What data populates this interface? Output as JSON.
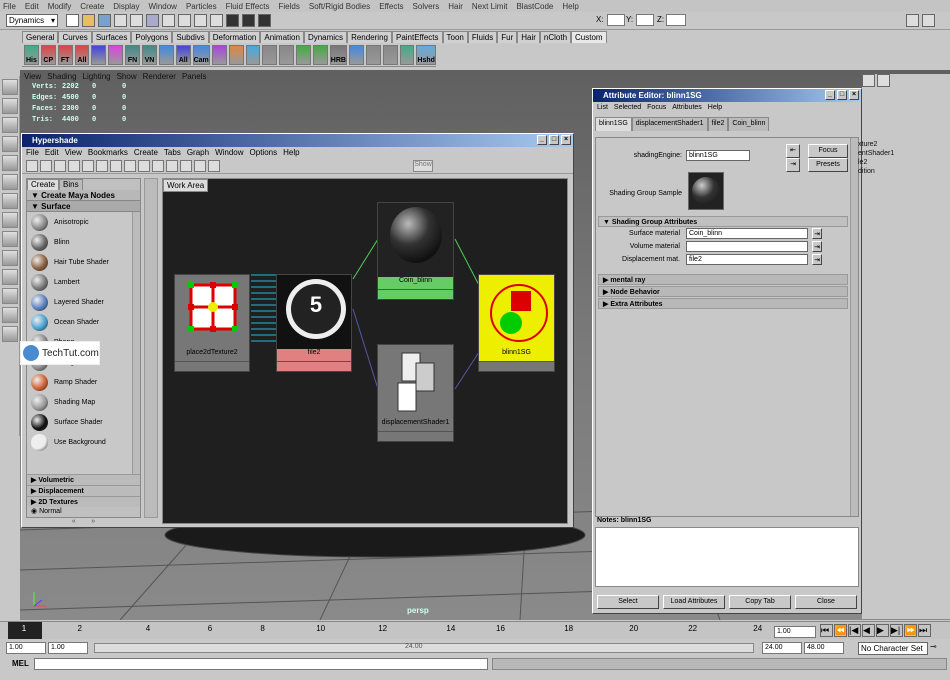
{
  "app": {
    "menu": [
      "File",
      "Edit",
      "Modify",
      "Create",
      "Display",
      "Window",
      "Particles",
      "Fluid Effects",
      "Fields",
      "Soft/Rigid Bodies",
      "Effects",
      "Solvers",
      "Hair",
      "Next Limit",
      "BlastCode",
      "Help"
    ],
    "mode_dropdown": "Dynamics",
    "xyz_labels": {
      "x": "X:",
      "y": "Y:",
      "z": "Z:"
    }
  },
  "shelf": {
    "tabs": [
      "General",
      "Curves",
      "Surfaces",
      "Polygons",
      "Subdivs",
      "Deformation",
      "Animation",
      "Dynamics",
      "Rendering",
      "PaintEffects",
      "Toon",
      "Fluids",
      "Fur",
      "Hair",
      "nCloth",
      "Custom"
    ],
    "active_tab": "Custom",
    "tools": [
      "His",
      "CP",
      "FT",
      "All",
      "",
      "",
      "FN",
      "VN",
      "",
      "All",
      "Cam",
      "",
      "",
      "",
      "",
      "",
      "",
      "",
      "HRB",
      "",
      "",
      "",
      "",
      "Hshd"
    ]
  },
  "viewport": {
    "menu": [
      "View",
      "Shading",
      "Lighting",
      "Show",
      "Renderer",
      "Panels"
    ],
    "hud": [
      {
        "label": "Verts:",
        "a": "2202",
        "b": "0",
        "c": "0"
      },
      {
        "label": "Edges:",
        "a": "4500",
        "b": "0",
        "c": "0"
      },
      {
        "label": "Faces:",
        "a": "2300",
        "b": "0",
        "c": "0"
      },
      {
        "label": "Tris:",
        "a": "4400",
        "b": "0",
        "c": "0"
      }
    ],
    "camera_label": "persp"
  },
  "hypershade": {
    "title": "Hypershade",
    "menu": [
      "File",
      "Edit",
      "View",
      "Bookmarks",
      "Create",
      "Tabs",
      "Graph",
      "Window",
      "Options",
      "Help"
    ],
    "show_button": "Show",
    "left_tabs": [
      "Create",
      "Bins"
    ],
    "create_header": "Create Maya Nodes",
    "surface_header": "Surface",
    "nodes": [
      {
        "name": "Anisotropic",
        "color": "#888"
      },
      {
        "name": "Blinn",
        "color": "#666"
      },
      {
        "name": "Hair Tube Shader",
        "color": "#8a6040"
      },
      {
        "name": "Lambert",
        "color": "#777"
      },
      {
        "name": "Layered Shader",
        "color": "#5a80c0"
      },
      {
        "name": "Ocean Shader",
        "color": "#4aa0d0"
      },
      {
        "name": "Phong",
        "color": "#888"
      },
      {
        "name": "Phong E",
        "color": "#888"
      },
      {
        "name": "Ramp Shader",
        "color": "#d06030"
      },
      {
        "name": "Shading Map",
        "color": "#999"
      },
      {
        "name": "Surface Shader",
        "color": "#111"
      },
      {
        "name": "Use Background",
        "color": "#eee"
      }
    ],
    "sections": [
      "Volumetric",
      "Displacement",
      "2D Textures"
    ],
    "normal_label": "Normal",
    "work_tab": "Work Area",
    "graph_nodes": {
      "place2d": "place2dTexture2",
      "file2": "file2",
      "coin": "Coin_blinn",
      "sg": "blinn1SG",
      "disp": "displacementShader1"
    }
  },
  "watermark": {
    "text": "TechTut.com"
  },
  "attribute_editor": {
    "title": "Attribute Editor: blinn1SG",
    "menu": [
      "List",
      "Selected",
      "Focus",
      "Attributes",
      "Help"
    ],
    "tabs": [
      "blinn1SG",
      "displacementShader1",
      "file2",
      "Coin_blinn"
    ],
    "shading_engine_label": "shadingEngine:",
    "shading_engine_value": "blinn1SG",
    "focus_button": "Focus",
    "presets_button": "Presets",
    "sample_label": "Shading Group Sample",
    "section_title": "Shading Group Attributes",
    "surface_label": "Surface material",
    "surface_value": "Coin_blinn",
    "volume_label": "Volume material",
    "volume_value": "",
    "displacement_label": "Displacement mat.",
    "displacement_value": "file2",
    "collapsed": [
      "mental ray",
      "Node Behavior",
      "Extra Attributes"
    ],
    "notes_label": "Notes:",
    "notes_node": "blinn1SG",
    "buttons": [
      "Select",
      "Load Attributes",
      "Copy Tab",
      "Close"
    ]
  },
  "right_panel": {
    "lines": [
      "xture2",
      "entShader1",
      "",
      "le2",
      "dition"
    ]
  },
  "timeline": {
    "ticks": [
      "1",
      "2",
      "4",
      "6",
      "8",
      "10",
      "12",
      "14",
      "16",
      "18",
      "20",
      "22",
      "24"
    ],
    "current_frame": "1.00",
    "range": {
      "start": "1.00",
      "start2": "1.00",
      "current": "24.00",
      "end": "48.00",
      "end_label": "24.00"
    },
    "character_set": "No Character Set"
  },
  "mel": {
    "label": "MEL"
  }
}
